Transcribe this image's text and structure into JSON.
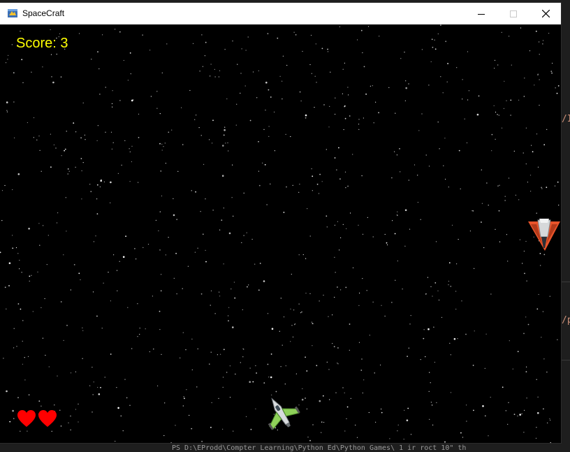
{
  "window": {
    "title": "SpaceCraft"
  },
  "hud": {
    "score_label": "Score: 3",
    "lives": 2
  },
  "colors": {
    "score_text": "#ffff00",
    "heart": "#ff0000",
    "background": "#000000"
  },
  "icons": {
    "app": "app-icon",
    "minimize": "minimize-icon",
    "maximize": "maximize-icon",
    "close": "close-icon",
    "life": "heart-icon",
    "player": "player-ship-icon",
    "enemy": "enemy-ship-icon"
  },
  "background_app": {
    "edge_text_1": "/I",
    "edge_text_2": "/p",
    "terminal_line": "PS D:\\EProdd\\Compter Learning\\Python Ed\\Python Games\\ 1 ir roct 10\"   th"
  }
}
